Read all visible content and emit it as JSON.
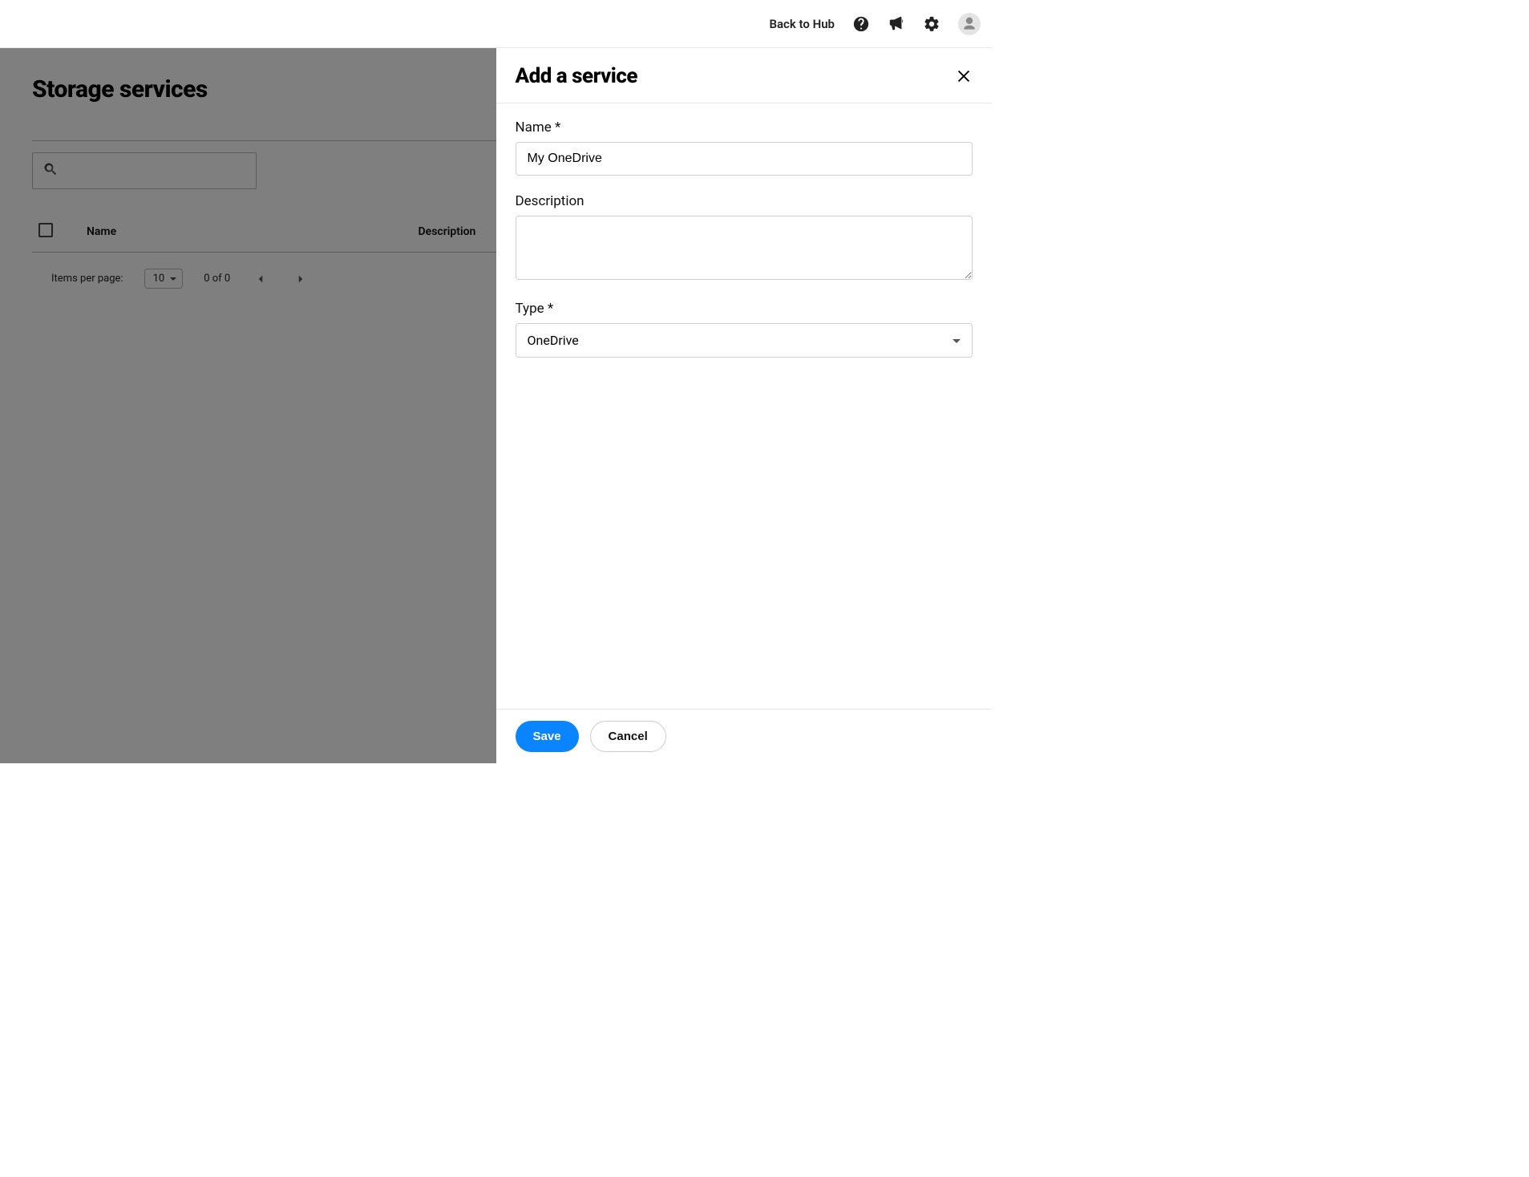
{
  "header": {
    "back_label": "Back to Hub"
  },
  "page": {
    "title": "Storage services",
    "search_placeholder": "",
    "columns": {
      "name": "Name",
      "description": "Description"
    },
    "paginator": {
      "items_label": "Items per page:",
      "page_size": "10",
      "range": "0 of 0"
    }
  },
  "panel": {
    "title": "Add a service",
    "name_label": "Name *",
    "name_value": "My OneDrive",
    "description_label": "Description",
    "description_value": "",
    "type_label": "Type *",
    "type_value": "OneDrive",
    "save_label": "Save",
    "cancel_label": "Cancel"
  }
}
